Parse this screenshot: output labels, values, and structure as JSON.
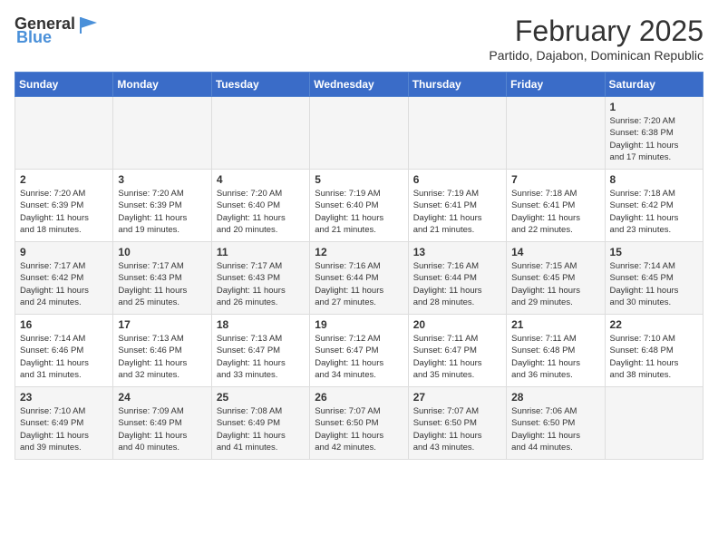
{
  "header": {
    "logo": {
      "general": "General",
      "blue": "Blue"
    },
    "title": "February 2025",
    "subtitle": "Partido, Dajabon, Dominican Republic"
  },
  "weekdays": [
    "Sunday",
    "Monday",
    "Tuesday",
    "Wednesday",
    "Thursday",
    "Friday",
    "Saturday"
  ],
  "weeks": [
    [
      {
        "day": "",
        "info": ""
      },
      {
        "day": "",
        "info": ""
      },
      {
        "day": "",
        "info": ""
      },
      {
        "day": "",
        "info": ""
      },
      {
        "day": "",
        "info": ""
      },
      {
        "day": "",
        "info": ""
      },
      {
        "day": "1",
        "info": "Sunrise: 7:20 AM\nSunset: 6:38 PM\nDaylight: 11 hours\nand 17 minutes."
      }
    ],
    [
      {
        "day": "2",
        "info": "Sunrise: 7:20 AM\nSunset: 6:39 PM\nDaylight: 11 hours\nand 18 minutes."
      },
      {
        "day": "3",
        "info": "Sunrise: 7:20 AM\nSunset: 6:39 PM\nDaylight: 11 hours\nand 19 minutes."
      },
      {
        "day": "4",
        "info": "Sunrise: 7:20 AM\nSunset: 6:40 PM\nDaylight: 11 hours\nand 20 minutes."
      },
      {
        "day": "5",
        "info": "Sunrise: 7:19 AM\nSunset: 6:40 PM\nDaylight: 11 hours\nand 21 minutes."
      },
      {
        "day": "6",
        "info": "Sunrise: 7:19 AM\nSunset: 6:41 PM\nDaylight: 11 hours\nand 21 minutes."
      },
      {
        "day": "7",
        "info": "Sunrise: 7:18 AM\nSunset: 6:41 PM\nDaylight: 11 hours\nand 22 minutes."
      },
      {
        "day": "8",
        "info": "Sunrise: 7:18 AM\nSunset: 6:42 PM\nDaylight: 11 hours\nand 23 minutes."
      }
    ],
    [
      {
        "day": "9",
        "info": "Sunrise: 7:17 AM\nSunset: 6:42 PM\nDaylight: 11 hours\nand 24 minutes."
      },
      {
        "day": "10",
        "info": "Sunrise: 7:17 AM\nSunset: 6:43 PM\nDaylight: 11 hours\nand 25 minutes."
      },
      {
        "day": "11",
        "info": "Sunrise: 7:17 AM\nSunset: 6:43 PM\nDaylight: 11 hours\nand 26 minutes."
      },
      {
        "day": "12",
        "info": "Sunrise: 7:16 AM\nSunset: 6:44 PM\nDaylight: 11 hours\nand 27 minutes."
      },
      {
        "day": "13",
        "info": "Sunrise: 7:16 AM\nSunset: 6:44 PM\nDaylight: 11 hours\nand 28 minutes."
      },
      {
        "day": "14",
        "info": "Sunrise: 7:15 AM\nSunset: 6:45 PM\nDaylight: 11 hours\nand 29 minutes."
      },
      {
        "day": "15",
        "info": "Sunrise: 7:14 AM\nSunset: 6:45 PM\nDaylight: 11 hours\nand 30 minutes."
      }
    ],
    [
      {
        "day": "16",
        "info": "Sunrise: 7:14 AM\nSunset: 6:46 PM\nDaylight: 11 hours\nand 31 minutes."
      },
      {
        "day": "17",
        "info": "Sunrise: 7:13 AM\nSunset: 6:46 PM\nDaylight: 11 hours\nand 32 minutes."
      },
      {
        "day": "18",
        "info": "Sunrise: 7:13 AM\nSunset: 6:47 PM\nDaylight: 11 hours\nand 33 minutes."
      },
      {
        "day": "19",
        "info": "Sunrise: 7:12 AM\nSunset: 6:47 PM\nDaylight: 11 hours\nand 34 minutes."
      },
      {
        "day": "20",
        "info": "Sunrise: 7:11 AM\nSunset: 6:47 PM\nDaylight: 11 hours\nand 35 minutes."
      },
      {
        "day": "21",
        "info": "Sunrise: 7:11 AM\nSunset: 6:48 PM\nDaylight: 11 hours\nand 36 minutes."
      },
      {
        "day": "22",
        "info": "Sunrise: 7:10 AM\nSunset: 6:48 PM\nDaylight: 11 hours\nand 38 minutes."
      }
    ],
    [
      {
        "day": "23",
        "info": "Sunrise: 7:10 AM\nSunset: 6:49 PM\nDaylight: 11 hours\nand 39 minutes."
      },
      {
        "day": "24",
        "info": "Sunrise: 7:09 AM\nSunset: 6:49 PM\nDaylight: 11 hours\nand 40 minutes."
      },
      {
        "day": "25",
        "info": "Sunrise: 7:08 AM\nSunset: 6:49 PM\nDaylight: 11 hours\nand 41 minutes."
      },
      {
        "day": "26",
        "info": "Sunrise: 7:07 AM\nSunset: 6:50 PM\nDaylight: 11 hours\nand 42 minutes."
      },
      {
        "day": "27",
        "info": "Sunrise: 7:07 AM\nSunset: 6:50 PM\nDaylight: 11 hours\nand 43 minutes."
      },
      {
        "day": "28",
        "info": "Sunrise: 7:06 AM\nSunset: 6:50 PM\nDaylight: 11 hours\nand 44 minutes."
      },
      {
        "day": "",
        "info": ""
      }
    ]
  ]
}
